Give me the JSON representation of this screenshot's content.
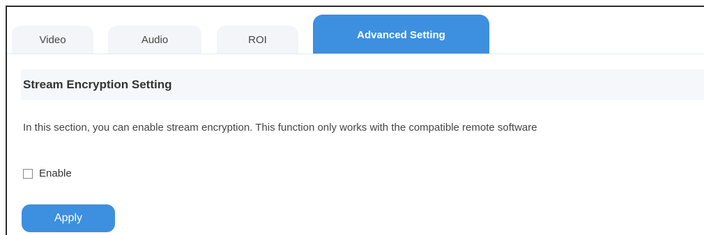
{
  "tabs": [
    {
      "label": "Video",
      "active": false
    },
    {
      "label": "Audio",
      "active": false
    },
    {
      "label": "ROI",
      "active": false
    },
    {
      "label": "Advanced Setting",
      "active": true
    }
  ],
  "section": {
    "title": "Stream Encryption Setting",
    "description": "In this section, you can enable stream encryption. This function only works with the compatible remote software"
  },
  "enable": {
    "label": "Enable",
    "checked": false
  },
  "apply": {
    "label": "Apply"
  },
  "colors": {
    "accent": "#3d8fe0",
    "tab_bg": "#f3f5f8",
    "header_bg": "#f5f7fa"
  }
}
